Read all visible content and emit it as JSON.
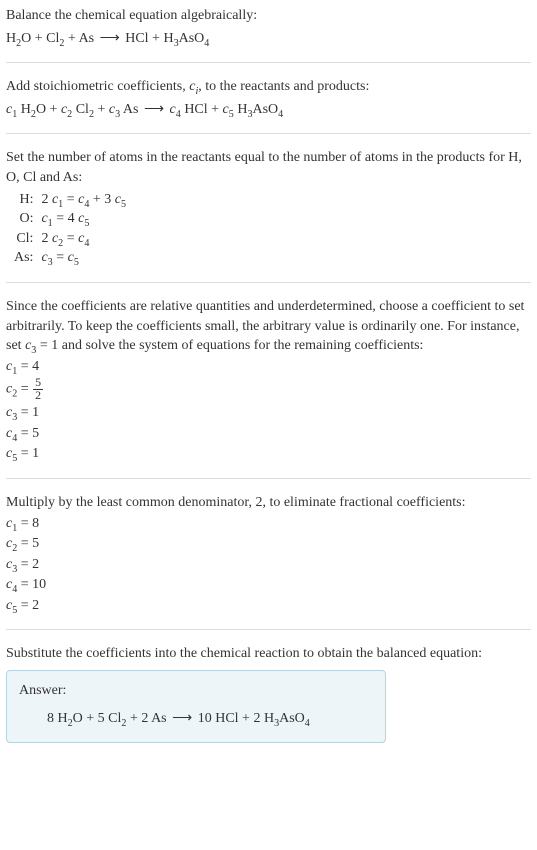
{
  "section1": {
    "intro": "Balance the chemical equation algebraically:",
    "eq_H2O": "H",
    "eq_2a": "2",
    "eq_O": "O + Cl",
    "eq_2b": "2",
    "eq_As": " + As  ",
    "eq_arrow": "⟶",
    "eq_HCl": "  HCl + H",
    "eq_3": "3",
    "eq_AsO": "AsO",
    "eq_4": "4"
  },
  "section2": {
    "intro_a": "Add stoichiometric coefficients, ",
    "ci_c": "c",
    "ci_i": "i",
    "intro_b": ", to the reactants and products:",
    "c1_c": "c",
    "c1_n": "1",
    "c1_sp": " H",
    "c1_s2": "2",
    "c1_sp2": "O + ",
    "c2_c": "c",
    "c2_n": "2",
    "c2_sp": " Cl",
    "c2_s2": "2",
    "c2_sp2": " + ",
    "c3_c": "c",
    "c3_n": "3",
    "c3_sp": " As  ",
    "arrow": "⟶",
    "c4_pre": "  ",
    "c4_c": "c",
    "c4_n": "4",
    "c4_sp": " HCl + ",
    "c5_c": "c",
    "c5_n": "5",
    "c5_sp": " H",
    "c5_s3": "3",
    "c5_sp2": "AsO",
    "c5_s4": "4"
  },
  "section3": {
    "intro": "Set the number of atoms in the reactants equal to the number of atoms in the products for H, O, Cl and As:",
    "rows": [
      {
        "label": "H:",
        "eq_a": "2 ",
        "c1c": "c",
        "c1n": "1",
        "eq_b": " = ",
        "c2c": "c",
        "c2n": "4",
        "eq_c": " + 3 ",
        "c3c": "c",
        "c3n": "5"
      },
      {
        "label": "O:",
        "eq_a": "",
        "c1c": "c",
        "c1n": "1",
        "eq_b": " = 4 ",
        "c2c": "c",
        "c2n": "5",
        "eq_c": "",
        "c3c": "",
        "c3n": ""
      },
      {
        "label": "Cl:",
        "eq_a": "2 ",
        "c1c": "c",
        "c1n": "2",
        "eq_b": " = ",
        "c2c": "c",
        "c2n": "4",
        "eq_c": "",
        "c3c": "",
        "c3n": ""
      },
      {
        "label": "As:",
        "eq_a": "",
        "c1c": "c",
        "c1n": "3",
        "eq_b": " = ",
        "c2c": "c",
        "c2n": "5",
        "eq_c": "",
        "c3c": "",
        "c3n": ""
      }
    ]
  },
  "section4": {
    "intro_a": "Since the coefficients are relative quantities and underdetermined, choose a coefficient to set arbitrarily. To keep the coefficients small, the arbitrary value is ordinarily one. For instance, set ",
    "c3_c": "c",
    "c3_n": "3",
    "intro_b": " = 1 and solve the system of equations for the remaining coefficients:",
    "lines": [
      {
        "cc": "c",
        "cn": "1",
        "val": " = 4",
        "frac": null
      },
      {
        "cc": "c",
        "cn": "2",
        "val": " = ",
        "frac": {
          "num": "5",
          "den": "2"
        }
      },
      {
        "cc": "c",
        "cn": "3",
        "val": " = 1",
        "frac": null
      },
      {
        "cc": "c",
        "cn": "4",
        "val": " = 5",
        "frac": null
      },
      {
        "cc": "c",
        "cn": "5",
        "val": " = 1",
        "frac": null
      }
    ]
  },
  "section5": {
    "intro": "Multiply by the least common denominator, 2, to eliminate fractional coefficients:",
    "lines": [
      {
        "cc": "c",
        "cn": "1",
        "val": " = 8"
      },
      {
        "cc": "c",
        "cn": "2",
        "val": " = 5"
      },
      {
        "cc": "c",
        "cn": "3",
        "val": " = 2"
      },
      {
        "cc": "c",
        "cn": "4",
        "val": " = 10"
      },
      {
        "cc": "c",
        "cn": "5",
        "val": " = 2"
      }
    ]
  },
  "section6": {
    "intro": "Substitute the coefficients into the chemical reaction to obtain the balanced equation:",
    "answer_label": "Answer:",
    "eq_8H": "8 H",
    "eq_2a": "2",
    "eq_O5Cl": "O + 5 Cl",
    "eq_2b": "2",
    "eq_2As": " + 2 As  ",
    "arrow": "⟶",
    "eq_10HCl": "  10 HCl + 2 H",
    "eq_3": "3",
    "eq_AsO": "AsO",
    "eq_4": "4"
  }
}
